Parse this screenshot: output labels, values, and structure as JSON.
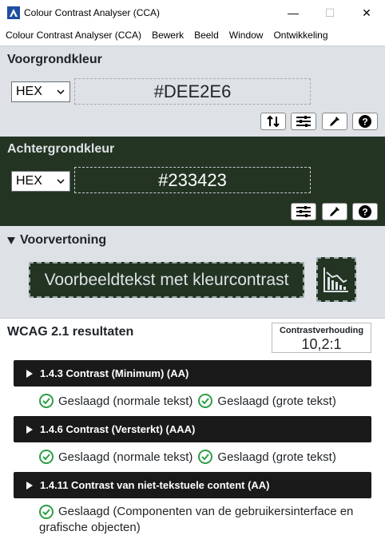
{
  "window": {
    "title": "Colour Contrast Analyser (CCA)",
    "minimize_glyph": "—",
    "maximize_glyph": "☐",
    "close_glyph": "✕"
  },
  "menu": {
    "items": [
      "Colour Contrast Analyser (CCA)",
      "Bewerk",
      "Beeld",
      "Window",
      "Ontwikkeling"
    ]
  },
  "foreground": {
    "title": "Voorgrondkleur",
    "format": "HEX",
    "value": "#DEE2E6",
    "color": "#dee2e6",
    "tools": [
      "swap-icon",
      "sliders-icon",
      "eyedropper-icon",
      "help-icon"
    ]
  },
  "background": {
    "title": "Achtergrondkleur",
    "format": "HEX",
    "value": "#233423",
    "color": "#233423",
    "tools": [
      "sliders-icon",
      "eyedropper-icon",
      "help-icon"
    ]
  },
  "preview": {
    "title": "Voorvertoning",
    "sample_text": "Voorbeeldtekst met kleurcontrast"
  },
  "results": {
    "title": "WCAG 2.1 resultaten",
    "ratio_label": "Contrastverhouding",
    "ratio_value": "10,2:1",
    "criteria": [
      {
        "label": "1.4.3 Contrast (Minimum) (AA)",
        "passes": [
          "Geslaagd (normale tekst)",
          "Geslaagd (grote tekst)"
        ]
      },
      {
        "label": "1.4.6 Contrast (Versterkt) (AAA)",
        "passes": [
          "Geslaagd (normale tekst)",
          "Geslaagd (grote tekst)"
        ]
      },
      {
        "label": "1.4.11 Contrast van niet-tekstuele content (AA)",
        "passes": [
          "Geslaagd (Componenten van de gebruikersinterface en grafische objecten)"
        ]
      }
    ]
  },
  "colors": {
    "pass_green": "#2e9e45",
    "criterion_bg": "#1a1a1a"
  }
}
